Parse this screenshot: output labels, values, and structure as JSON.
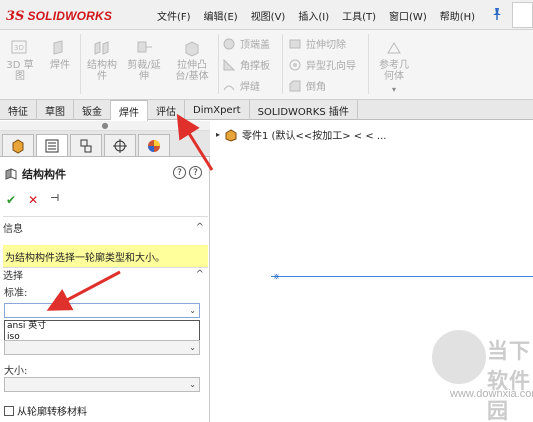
{
  "titlebar": {
    "logo_text": "SOLIDWORKS",
    "menu": [
      "文件(F)",
      "编辑(E)",
      "视图(V)",
      "插入(I)",
      "工具(T)",
      "窗口(W)",
      "帮助(H)"
    ]
  },
  "ribbon": {
    "buttons": [
      {
        "label": "3D 草图",
        "icon": "sketch3d-icon"
      },
      {
        "label": "焊件",
        "icon": "weldment-icon"
      },
      {
        "label": "结构构\n件",
        "icon": "structural-member-icon"
      },
      {
        "label": "剪裁/延\n伸",
        "icon": "trim-extend-icon"
      },
      {
        "label": "拉伸凸\n台/基体",
        "icon": "extrude-boss-icon"
      },
      {
        "label": "参考几\n何体",
        "icon": "reference-geometry-icon"
      }
    ],
    "small_col1": [
      {
        "label": "顶端盖",
        "icon": "end-cap-icon"
      },
      {
        "label": "角撑板",
        "icon": "gusset-icon"
      },
      {
        "label": "焊缝",
        "icon": "weld-bead-icon"
      }
    ],
    "small_col2": [
      {
        "label": "拉伸切除",
        "icon": "extruded-cut-icon"
      },
      {
        "label": "异型孔向导",
        "icon": "hole-wizard-icon"
      },
      {
        "label": "倒角",
        "icon": "chamfer-icon"
      }
    ]
  },
  "tabs": [
    {
      "label": "特征",
      "active": false
    },
    {
      "label": "草图",
      "active": false
    },
    {
      "label": "钣金",
      "active": false
    },
    {
      "label": "焊件",
      "active": true
    },
    {
      "label": "评估",
      "active": false
    },
    {
      "label": "DimXpert",
      "active": false
    },
    {
      "label": "SOLIDWORKS 插件",
      "active": false
    }
  ],
  "panel": {
    "title": "结构构件",
    "info_header": "信息",
    "info_text": "为结构构件选择一轮廓类型和大小。",
    "selection_header": "选择",
    "standard_label": "标准:",
    "standard_value": "",
    "dropdown_options": [
      "ansi 英寸",
      "iso"
    ],
    "size_label": "大小:",
    "checkbox_label": "从轮廓转移材料"
  },
  "tree": {
    "part_label": "零件1  (默认<<按加工> < < ..."
  },
  "watermark": {
    "brand": "当下软件园",
    "url": "www.downxia.com"
  },
  "colors": {
    "accent_red": "#d0161b",
    "info_yellow": "#ffff9c",
    "sketch_blue": "#3f82e0",
    "arrow_red": "#e0302b"
  }
}
